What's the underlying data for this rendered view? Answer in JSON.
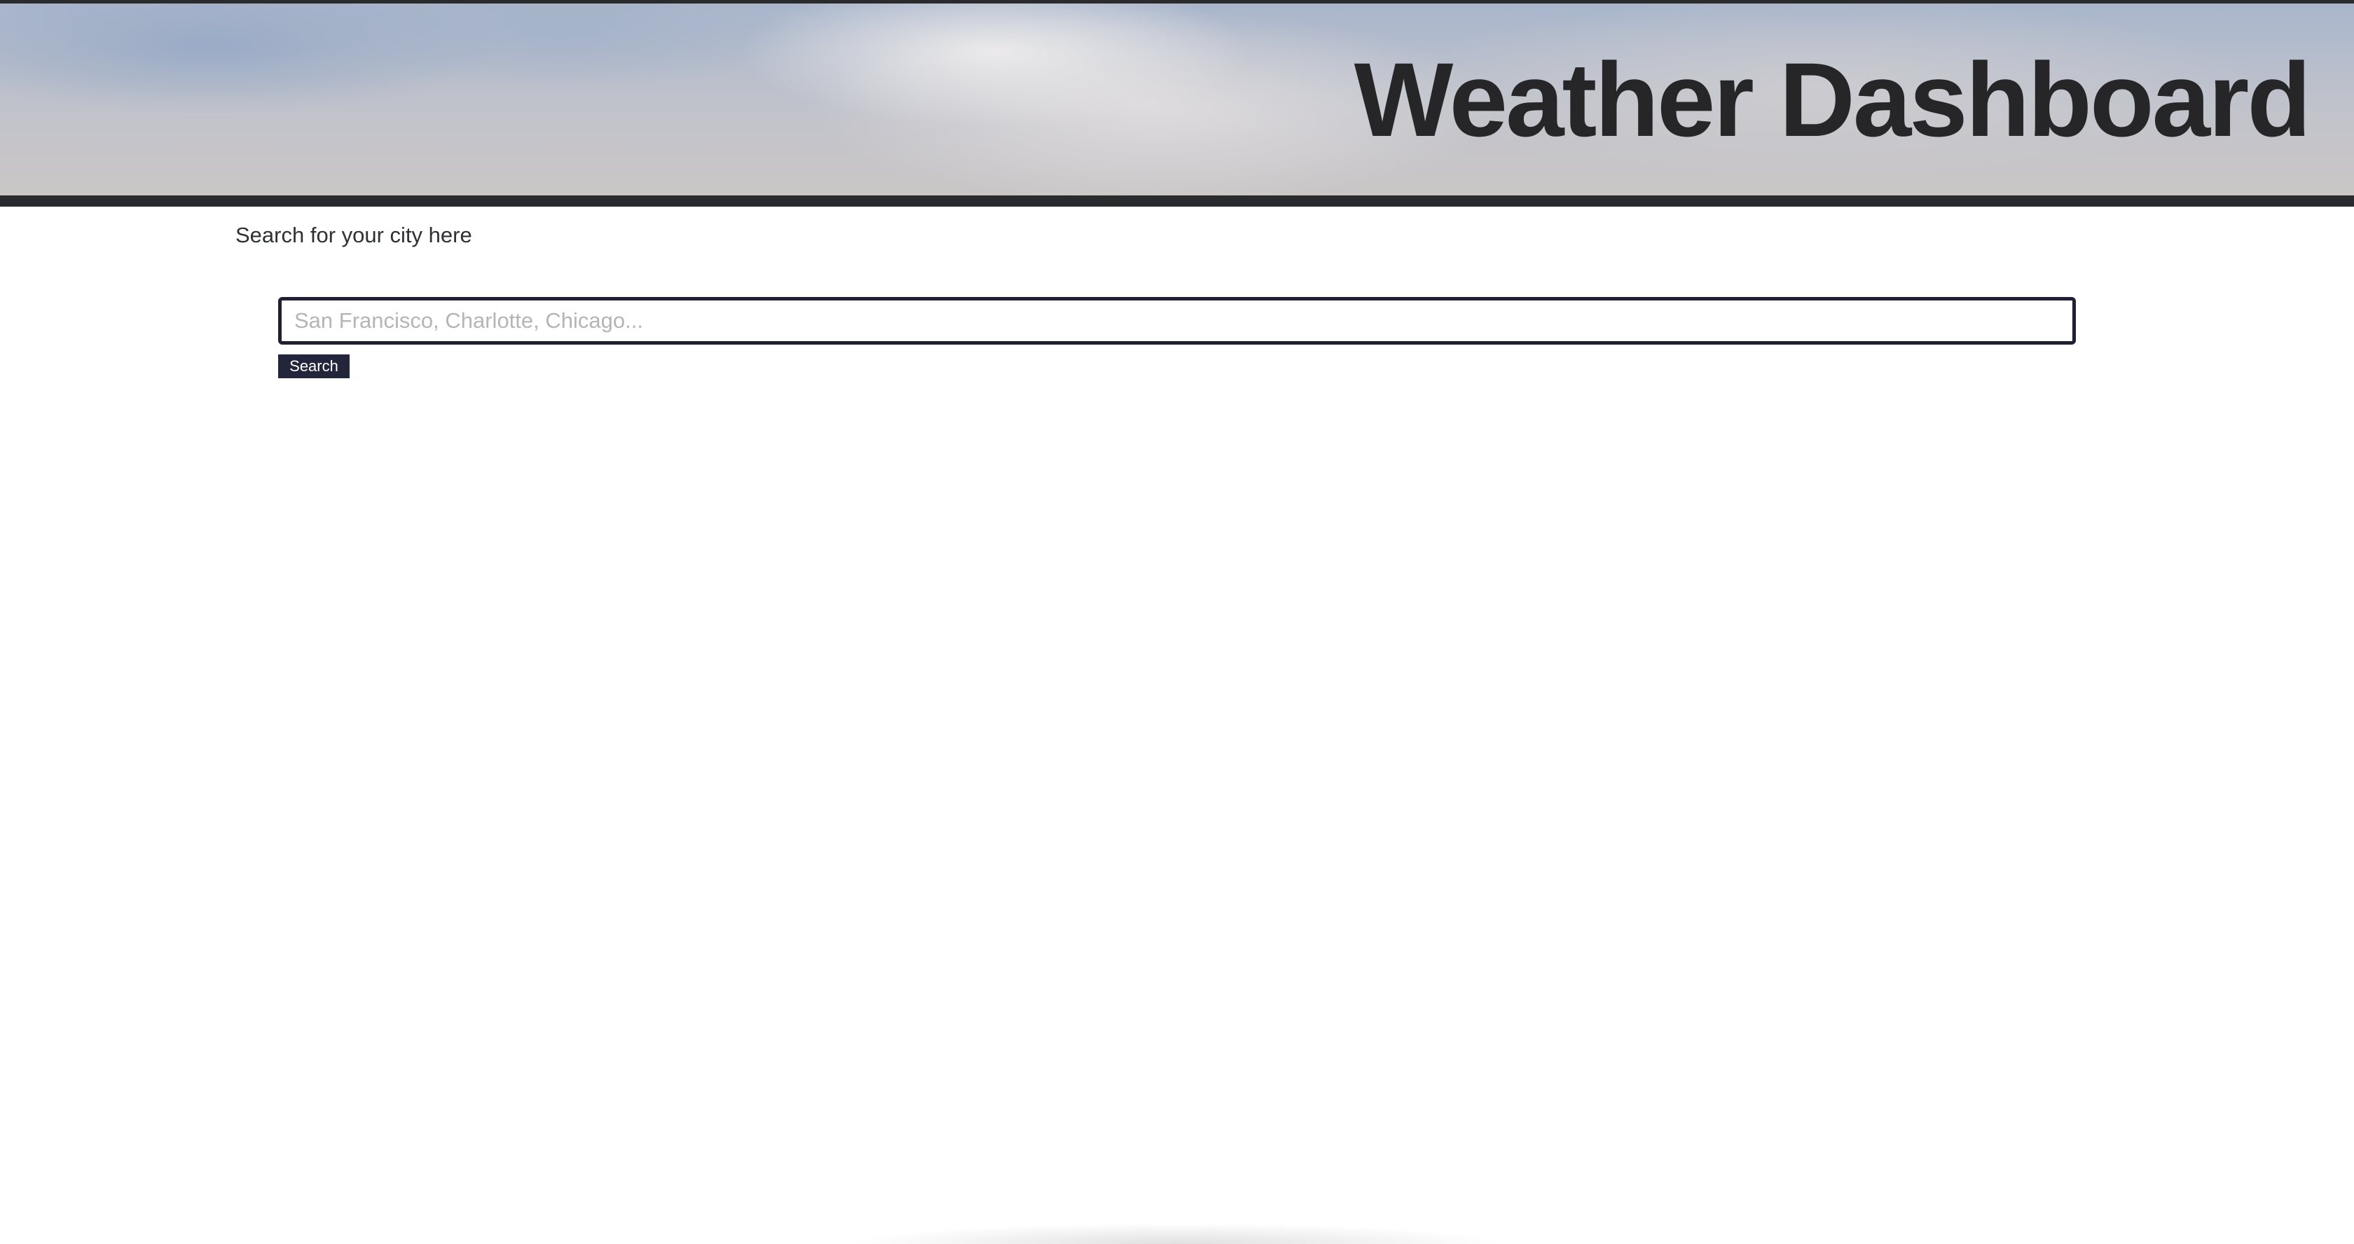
{
  "header": {
    "title": "Weather Dashboard"
  },
  "search": {
    "label": "Search for your city here",
    "placeholder": "San Francisco, Charlotte, Chicago...",
    "value": "",
    "button_label": "Search"
  },
  "colors": {
    "header_bar": "#2a2b2e",
    "title_text": "#262629",
    "input_border": "#1f2033",
    "button_bg": "#23253a",
    "button_text": "#ffffff",
    "placeholder_text": "#b5b5b8"
  }
}
